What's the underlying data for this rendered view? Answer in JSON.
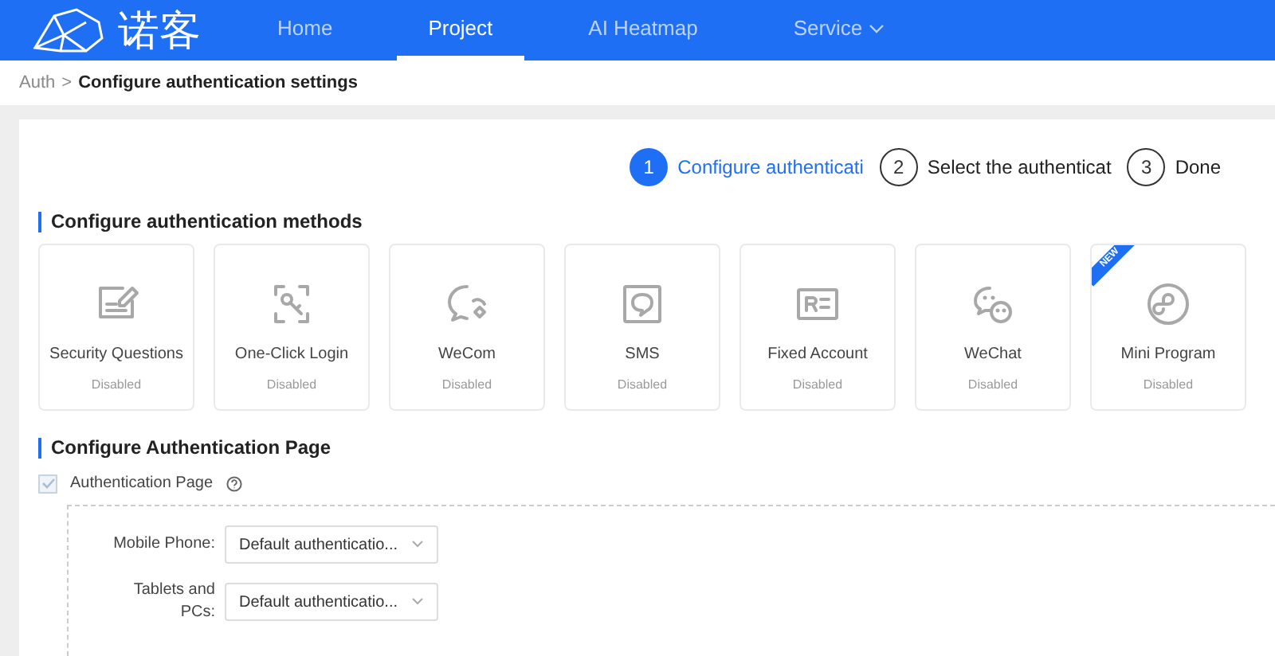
{
  "header": {
    "logo_text": "诺客",
    "nav": [
      {
        "label": "Home",
        "selected": false
      },
      {
        "label": "Project",
        "selected": true
      },
      {
        "label": "AI Heatmap",
        "selected": false
      },
      {
        "label": "Service",
        "selected": false,
        "dropdown": true
      }
    ]
  },
  "breadcrumb": {
    "parent": "Auth",
    "separator": ">",
    "current": "Configure authentication settings"
  },
  "steps": [
    {
      "number": "1",
      "label": "Configure authenticati",
      "selected": true
    },
    {
      "number": "2",
      "label": "Select the authenticat",
      "selected": false
    },
    {
      "number": "3",
      "label": "Done",
      "selected": false
    }
  ],
  "methods_section": {
    "title": "Configure authentication methods",
    "methods": [
      {
        "name": "Security Questions",
        "status": "Disabled"
      },
      {
        "name": "One-Click Login",
        "status": "Disabled"
      },
      {
        "name": "WeCom",
        "status": "Disabled"
      },
      {
        "name": "SMS",
        "status": "Disabled"
      },
      {
        "name": "Fixed Account",
        "status": "Disabled"
      },
      {
        "name": "WeChat",
        "status": "Disabled"
      },
      {
        "name": "Mini Program",
        "status": "Disabled",
        "badge": "NEW"
      }
    ]
  },
  "page_section": {
    "title": "Configure Authentication Page",
    "checkbox": {
      "label": "Authentication Page",
      "checked": true
    },
    "fields": [
      {
        "label": "Mobile Phone:",
        "value": "Default authenticatio..."
      },
      {
        "label": "Tablets and PCs:",
        "value": "Default authenticatio..."
      }
    ]
  }
}
